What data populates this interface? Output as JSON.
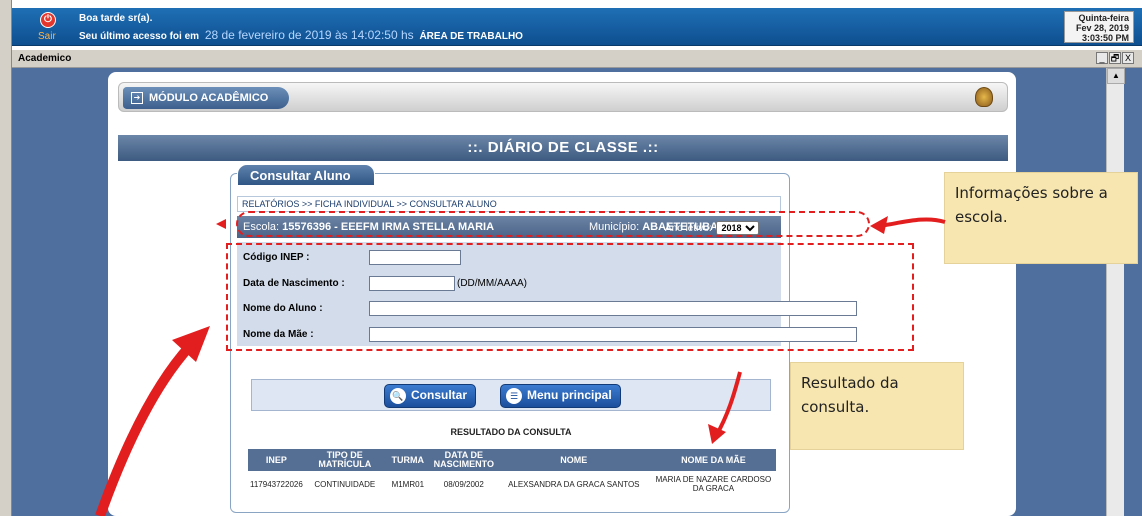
{
  "topbar": {
    "sair_label": "Sair",
    "greeting": "Boa tarde sr(a).",
    "last_access_prefix": "Seu último acesso foi em",
    "last_access_date": "28 de fevereiro de 2019 às 14:02:50 hs",
    "workspace_link": "ÁREA DE TRABALHO",
    "clock_day": "Quinta-feira",
    "clock_date": "Fev 28, 2019",
    "clock_time": "3:03:50 PM"
  },
  "window": {
    "title": "Academico",
    "controls": [
      "_",
      "🗗",
      "X"
    ]
  },
  "module": {
    "button_label": "MÓDULO ACADÊMICO",
    "page_title": "::. DIÁRIO DE CLASSE .::"
  },
  "consulta": {
    "tab_label": "Consultar Aluno",
    "breadcrumb": "RELATÓRIOS >> FICHA INDIVIDUAL >> CONSULTAR ALUNO",
    "escola_label": "Escola:",
    "escola_value": "15576396 - EEEFM IRMA STELLA MARIA",
    "municipio_label": "Município:",
    "municipio_value": "ABAETETUBA",
    "ano_label": "Ano letivo:",
    "ano_value": "2018",
    "fields": {
      "inep_label": "Código INEP :",
      "inep_value": "",
      "nascimento_label": "Data de Nascimento :",
      "nascimento_value": "",
      "nascimento_format": "(DD/MM/AAAA)",
      "aluno_label": "Nome do Aluno :",
      "aluno_value": "",
      "mae_label": "Nome da Mãe :",
      "mae_value": ""
    },
    "buttons": {
      "consultar": "Consultar",
      "menu": "Menu principal"
    },
    "result_title": "RESULTADO DA CONSULTA",
    "table": {
      "headers": [
        "INEP",
        "TIPO DE MATRÍCULA",
        "TURMA",
        "DATA DE NASCIMENTO",
        "NOME",
        "NOME DA MÃE"
      ],
      "rows": [
        [
          "117943722026",
          "CONTINUIDADE",
          "M1MR01",
          "08/09/2002",
          "ALEXSANDRA DA GRACA SANTOS",
          "MARIA DE NAZARE CARDOSO DA GRACA"
        ]
      ]
    }
  },
  "annotations": {
    "note_school": "Informações sobre a escola.",
    "note_result": "Resultado da consulta."
  },
  "colors": {
    "topbar": "#1f6fb5",
    "header_bar": "#556e93",
    "annotation_red": "#e31e1e",
    "note_bg": "#f7e6b0"
  }
}
